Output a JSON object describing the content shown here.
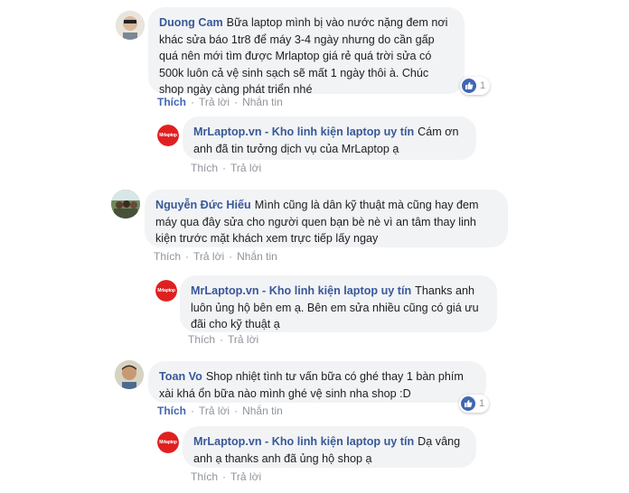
{
  "comments": [
    {
      "author": "Duong Cam",
      "text": "Bữa laptop mình bị vào nước nặng đem nơi khác sửa báo 1tr8 để máy 3-4 ngày nhưng do cần gấp quá nên mới tìm được Mrlaptop giá rẻ quá trời sửa có 500k luôn cả vệ sinh sạch sẽ mất 1 ngày thôi à. Chúc shop ngày càng phát triển nhé",
      "like_label": "Thích",
      "reply_label": "Trả lời",
      "message_label": "Nhắn tin",
      "reaction_count": "1",
      "reply": {
        "author": "MrLaptop.vn - Kho linh kiện laptop uy tín",
        "text": "Cám ơn anh đã tin tưởng dịch vụ của MrLaptop ạ",
        "like_label": "Thích",
        "reply_label": "Trả lời"
      }
    },
    {
      "author": "Nguyễn Đức Hiếu",
      "text": "Mình cũng là dân kỹ thuật mà cũng hay đem máy qua đây sửa cho người quen bạn bè nè vì an tâm thay linh kiện trước mặt khách xem trực tiếp lấy ngay",
      "like_label": "Thích",
      "reply_label": "Trả lời",
      "message_label": "Nhắn tin",
      "reply": {
        "author": "MrLaptop.vn - Kho linh kiện laptop uy tín",
        "text": "Thanks anh luôn ủng hộ bên em ạ. Bên em sửa nhiều cũng có giá ưu đãi cho kỹ thuật ạ",
        "like_label": "Thích",
        "reply_label": "Trả lời"
      }
    },
    {
      "author": "Toan Vo",
      "text": "Shop nhiệt tình tư vấn bữa có ghé thay 1 bàn phím xài khá ổn bữa nào mình ghé vệ sinh nha shop :D",
      "like_label": "Thích",
      "reply_label": "Trả lời",
      "message_label": "Nhắn tin",
      "reaction_count": "1",
      "reply": {
        "author": "MrLaptop.vn - Kho linh kiện laptop uy tín",
        "text": "Dạ vâng anh ạ thanks anh đã ủng hộ shop ạ",
        "like_label": "Thích",
        "reply_label": "Trả lời"
      }
    }
  ],
  "shop_logo_text": "Mrlaptop",
  "colors": {
    "name_link": "#385898",
    "bubble_bg": "#f2f3f5",
    "meta_gray": "#90949c",
    "liked_blue": "#4267b2",
    "shop_red": "#e02020"
  }
}
